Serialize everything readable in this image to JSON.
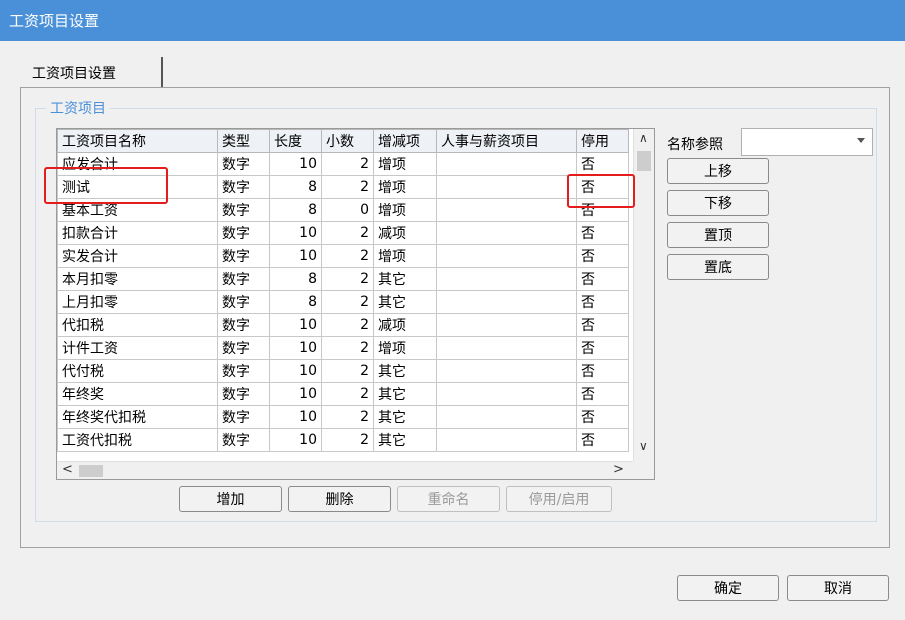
{
  "window": {
    "title": "工资项目设置"
  },
  "tab": {
    "label": "工资项目设置"
  },
  "group": {
    "legend": "工资项目"
  },
  "grid": {
    "columns": [
      "工资项目名称",
      "类型",
      "长度",
      "小数",
      "增减项",
      "人事与薪资项目",
      "停用"
    ],
    "rows": [
      [
        "应发合计",
        "数字",
        "10",
        "2",
        "增项",
        "",
        "否"
      ],
      [
        "测试",
        "数字",
        "8",
        "2",
        "增项",
        "",
        "否"
      ],
      [
        "基本工资",
        "数字",
        "8",
        "0",
        "增项",
        "",
        "否"
      ],
      [
        "扣款合计",
        "数字",
        "10",
        "2",
        "减项",
        "",
        "否"
      ],
      [
        "实发合计",
        "数字",
        "10",
        "2",
        "增项",
        "",
        "否"
      ],
      [
        "本月扣零",
        "数字",
        "8",
        "2",
        "其它",
        "",
        "否"
      ],
      [
        "上月扣零",
        "数字",
        "8",
        "2",
        "其它",
        "",
        "否"
      ],
      [
        "代扣税",
        "数字",
        "10",
        "2",
        "减项",
        "",
        "否"
      ],
      [
        "计件工资",
        "数字",
        "10",
        "2",
        "增项",
        "",
        "否"
      ],
      [
        "代付税",
        "数字",
        "10",
        "2",
        "其它",
        "",
        "否"
      ],
      [
        "年终奖",
        "数字",
        "10",
        "2",
        "其它",
        "",
        "否"
      ],
      [
        "年终奖代扣税",
        "数字",
        "10",
        "2",
        "其它",
        "",
        "否"
      ],
      [
        "工资代扣税",
        "数字",
        "10",
        "2",
        "其它",
        "",
        "否"
      ]
    ]
  },
  "side": {
    "ref_label": "名称参照",
    "ref_value": "",
    "move_up": "上移",
    "move_down": "下移",
    "move_top": "置顶",
    "move_bottom": "置底"
  },
  "actions": {
    "add": "增加",
    "delete": "删除",
    "rename": "重命名",
    "toggle": "停用/启用"
  },
  "footer": {
    "ok": "确定",
    "cancel": "取消"
  },
  "colors": {
    "titlebar": "#4a90d9",
    "highlight": "#e51c1c",
    "legend": "#4a90d9"
  }
}
